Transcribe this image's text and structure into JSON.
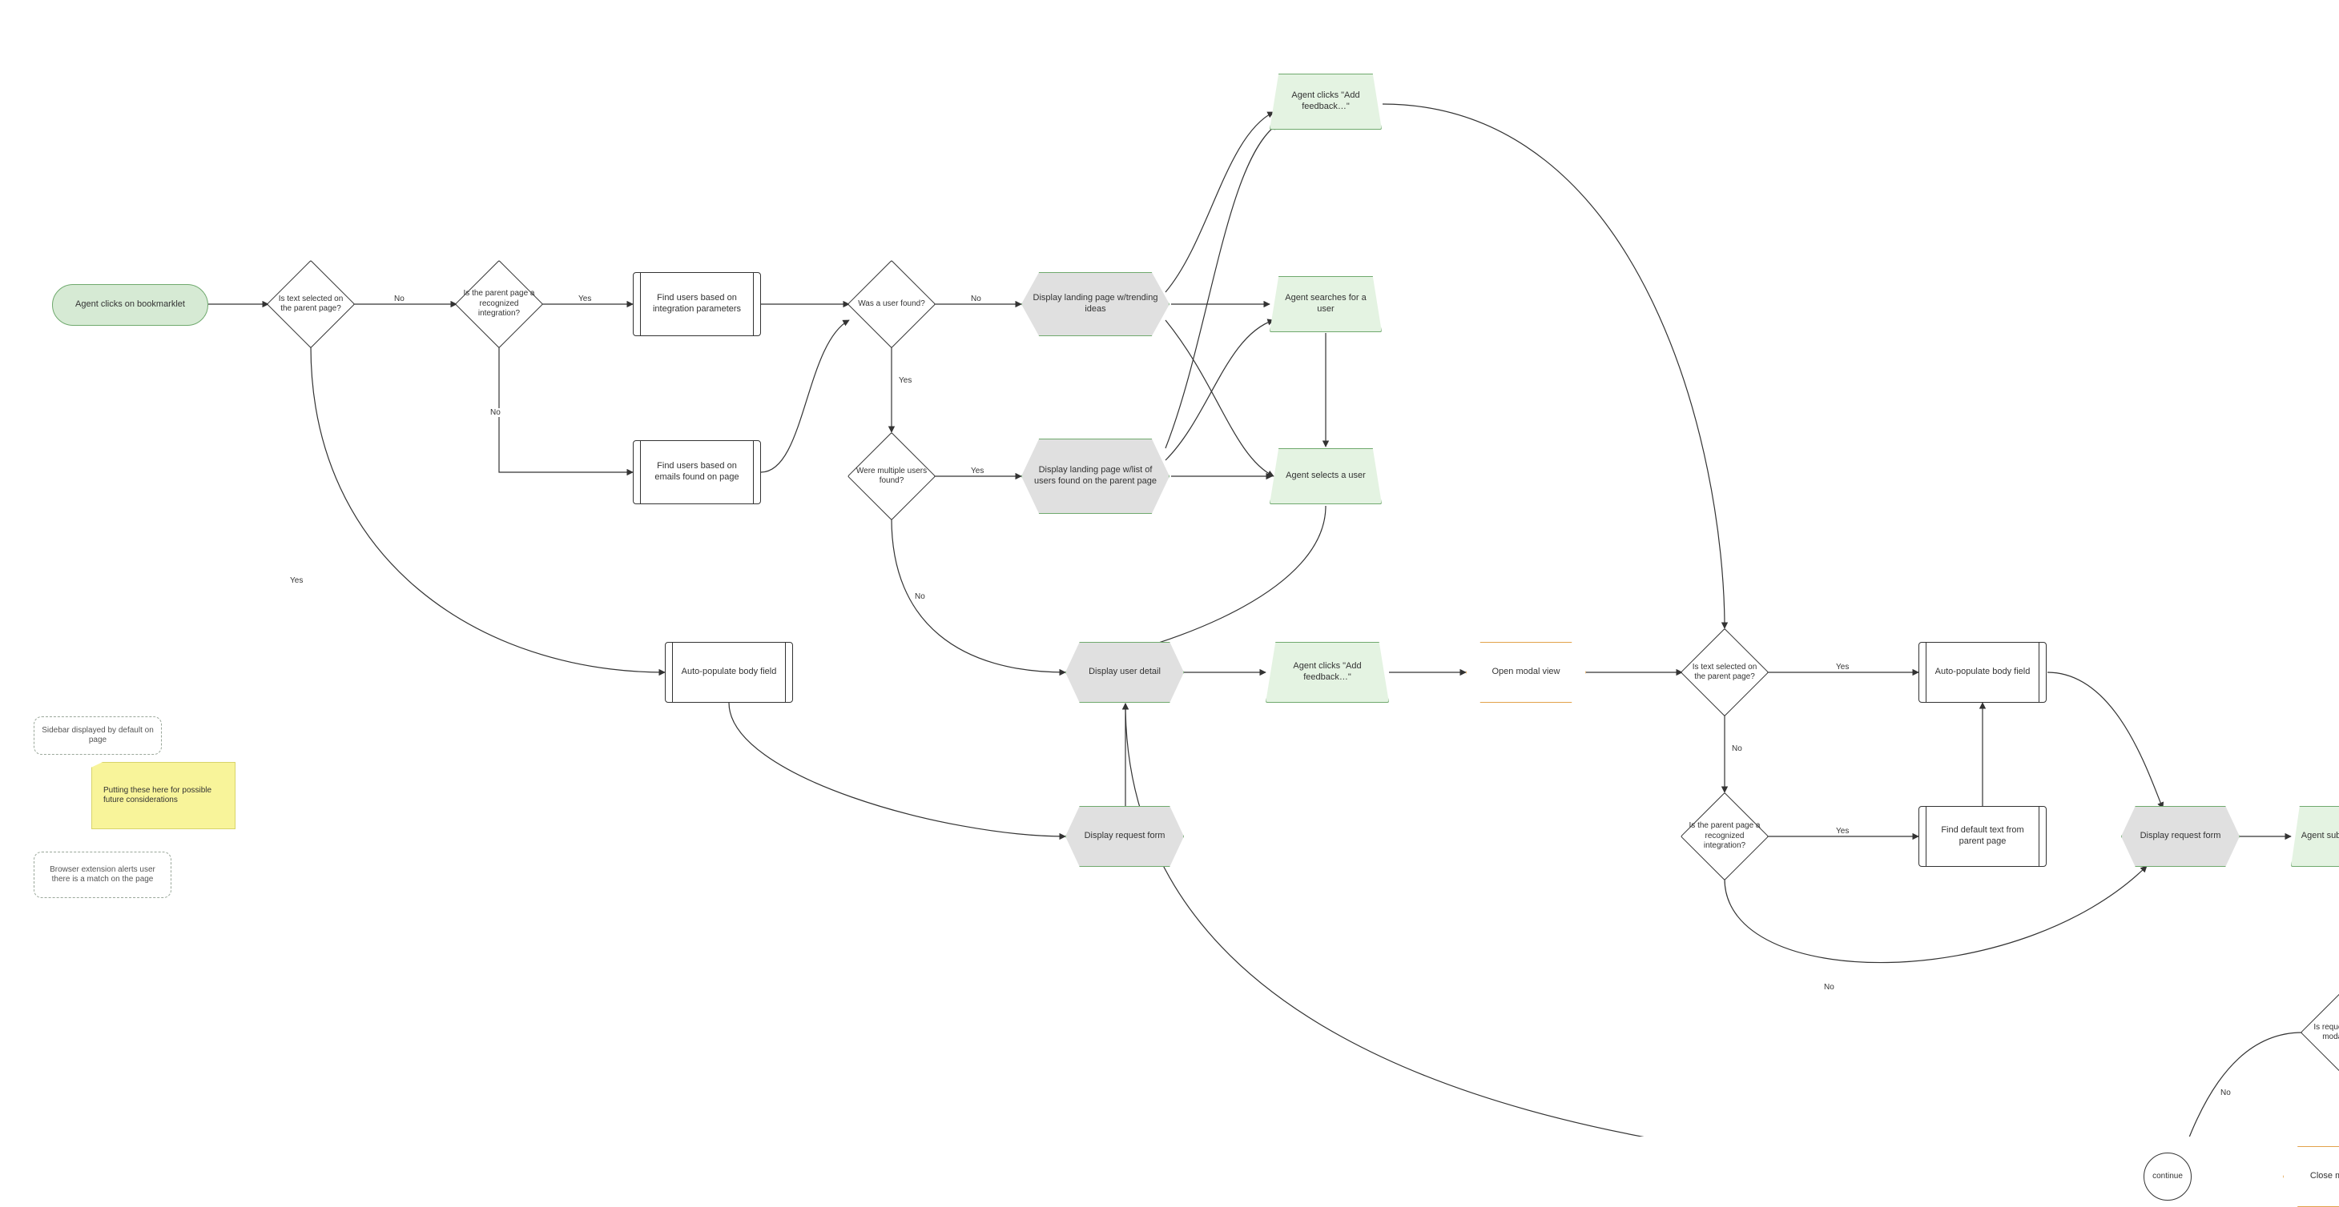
{
  "nodes": {
    "start": {
      "label": "Agent clicks on bookmarklet"
    },
    "d_text_sel_1": {
      "label": "Is text selected on the parent page?"
    },
    "d_recog_1": {
      "label": "Is the parent page a recognized integration?"
    },
    "p_find_int": {
      "label": "Find users based on integration parameters"
    },
    "p_find_email": {
      "label": "Find users based on emails found on page"
    },
    "d_user_found": {
      "label": "Was a user found?"
    },
    "d_multi_found": {
      "label": "Were multiple users found?"
    },
    "disp_trending": {
      "label": "Display landing page w/trending ideas"
    },
    "disp_userlist": {
      "label": "Display landing page w/list of users found on the parent page"
    },
    "ua_add_fb_top": {
      "label": "Agent clicks \"Add feedback…\""
    },
    "ua_search_user": {
      "label": "Agent searches for a user"
    },
    "ua_select_user": {
      "label": "Agent selects a user"
    },
    "p_autopop_1": {
      "label": "Auto-populate body field"
    },
    "disp_user_detail": {
      "label": "Display user detail"
    },
    "ua_add_fb_mid": {
      "label": "Agent clicks \"Add feedback…\""
    },
    "prep_open_modal": {
      "label": "Open modal view"
    },
    "d_text_sel_2": {
      "label": "Is text selected on the parent page?"
    },
    "d_recog_2": {
      "label": "Is the parent page a recognized integration?"
    },
    "p_autopop_2": {
      "label": "Auto-populate body field"
    },
    "p_find_default": {
      "label": "Find default text from parent page"
    },
    "disp_req_form_L": {
      "label": "Display request form"
    },
    "disp_req_form_R": {
      "label": "Display request form"
    },
    "ua_submit": {
      "label": "Agent submits request"
    },
    "d_in_modal": {
      "label": "Is request form in modal view?"
    },
    "prep_close_modal": {
      "label": "Close modal view"
    },
    "conn_continue": {
      "label": "continue"
    },
    "ann_sidebar": {
      "label": "Sidebar displayed by default on page"
    },
    "ann_extension": {
      "label": "Browser extension alerts user there is a match on the page"
    },
    "sticky": {
      "label": "Putting these here for possible future considerations"
    }
  },
  "edge_labels": {
    "no": "No",
    "yes": "Yes"
  },
  "chart_data": {
    "type": "flowchart",
    "nodes": [
      {
        "id": "start",
        "shape": "terminator",
        "text": "Agent clicks on bookmarklet"
      },
      {
        "id": "d_text_sel_1",
        "shape": "decision",
        "text": "Is text selected on the parent page?"
      },
      {
        "id": "d_recog_1",
        "shape": "decision",
        "text": "Is the parent page a recognized integration?"
      },
      {
        "id": "p_find_int",
        "shape": "predefined",
        "text": "Find users based on integration parameters"
      },
      {
        "id": "p_find_email",
        "shape": "predefined",
        "text": "Find users based on emails found on page"
      },
      {
        "id": "d_user_found",
        "shape": "decision",
        "text": "Was a user found?"
      },
      {
        "id": "d_multi_found",
        "shape": "decision",
        "text": "Were multiple users found?"
      },
      {
        "id": "disp_trending",
        "shape": "display",
        "text": "Display landing page w/trending ideas"
      },
      {
        "id": "disp_userlist",
        "shape": "display",
        "text": "Display landing page w/list of users found on the parent page"
      },
      {
        "id": "ua_add_fb_top",
        "shape": "manual-input",
        "text": "Agent clicks \"Add feedback…\""
      },
      {
        "id": "ua_search_user",
        "shape": "manual-input",
        "text": "Agent searches for a user"
      },
      {
        "id": "ua_select_user",
        "shape": "manual-input",
        "text": "Agent selects a user"
      },
      {
        "id": "p_autopop_1",
        "shape": "predefined",
        "text": "Auto-populate body field"
      },
      {
        "id": "disp_user_detail",
        "shape": "display",
        "text": "Display user detail"
      },
      {
        "id": "ua_add_fb_mid",
        "shape": "manual-input",
        "text": "Agent clicks \"Add feedback…\""
      },
      {
        "id": "prep_open_modal",
        "shape": "preparation",
        "text": "Open modal view"
      },
      {
        "id": "d_text_sel_2",
        "shape": "decision",
        "text": "Is text selected on the parent page?"
      },
      {
        "id": "d_recog_2",
        "shape": "decision",
        "text": "Is the parent page a recognized integration?"
      },
      {
        "id": "p_autopop_2",
        "shape": "predefined",
        "text": "Auto-populate body field"
      },
      {
        "id": "p_find_default",
        "shape": "predefined",
        "text": "Find default text from parent page"
      },
      {
        "id": "disp_req_form_L",
        "shape": "display",
        "text": "Display request form"
      },
      {
        "id": "disp_req_form_R",
        "shape": "display",
        "text": "Display request form"
      },
      {
        "id": "ua_submit",
        "shape": "manual-input",
        "text": "Agent submits request"
      },
      {
        "id": "d_in_modal",
        "shape": "decision",
        "text": "Is request form in modal view?"
      },
      {
        "id": "prep_close_modal",
        "shape": "preparation",
        "text": "Close modal view"
      },
      {
        "id": "conn_continue",
        "shape": "connector",
        "text": "continue"
      }
    ],
    "annotations": [
      {
        "id": "ann_sidebar",
        "text": "Sidebar displayed by default on page"
      },
      {
        "id": "ann_extension",
        "text": "Browser extension alerts user there is a match on the page"
      },
      {
        "id": "sticky",
        "text": "Putting these here for possible future considerations"
      }
    ],
    "edges": [
      {
        "from": "start",
        "to": "d_text_sel_1",
        "label": null
      },
      {
        "from": "d_text_sel_1",
        "to": "d_recog_1",
        "label": "No"
      },
      {
        "from": "d_text_sel_1",
        "to": "p_autopop_1",
        "label": "Yes"
      },
      {
        "from": "d_recog_1",
        "to": "p_find_int",
        "label": "Yes"
      },
      {
        "from": "d_recog_1",
        "to": "p_find_email",
        "label": "No"
      },
      {
        "from": "p_find_int",
        "to": "d_user_found",
        "label": null
      },
      {
        "from": "p_find_email",
        "to": "d_user_found",
        "label": null
      },
      {
        "from": "d_user_found",
        "to": "disp_trending",
        "label": "No"
      },
      {
        "from": "d_user_found",
        "to": "d_multi_found",
        "label": "Yes"
      },
      {
        "from": "d_multi_found",
        "to": "disp_userlist",
        "label": "Yes"
      },
      {
        "from": "d_multi_found",
        "to": "disp_user_detail",
        "label": "No"
      },
      {
        "from": "disp_trending",
        "to": "ua_add_fb_top",
        "label": null
      },
      {
        "from": "disp_trending",
        "to": "ua_search_user",
        "label": null
      },
      {
        "from": "disp_trending",
        "to": "ua_select_user",
        "label": null
      },
      {
        "from": "disp_userlist",
        "to": "ua_add_fb_top",
        "label": null
      },
      {
        "from": "disp_userlist",
        "to": "ua_search_user",
        "label": null
      },
      {
        "from": "disp_userlist",
        "to": "ua_select_user",
        "label": null
      },
      {
        "from": "ua_search_user",
        "to": "ua_select_user",
        "label": null
      },
      {
        "from": "ua_select_user",
        "to": "disp_user_detail",
        "label": null
      },
      {
        "from": "disp_user_detail",
        "to": "ua_add_fb_mid",
        "label": null
      },
      {
        "from": "ua_add_fb_mid",
        "to": "prep_open_modal",
        "label": null
      },
      {
        "from": "ua_add_fb_top",
        "to": "d_text_sel_2",
        "label": null
      },
      {
        "from": "prep_open_modal",
        "to": "d_text_sel_2",
        "label": null
      },
      {
        "from": "d_text_sel_2",
        "to": "p_autopop_2",
        "label": "Yes"
      },
      {
        "from": "d_text_sel_2",
        "to": "d_recog_2",
        "label": "No"
      },
      {
        "from": "d_recog_2",
        "to": "p_find_default",
        "label": "Yes"
      },
      {
        "from": "d_recog_2",
        "to": "disp_req_form_R",
        "label": "No"
      },
      {
        "from": "p_find_default",
        "to": "p_autopop_2",
        "label": null
      },
      {
        "from": "p_autopop_2",
        "to": "disp_req_form_R",
        "label": null
      },
      {
        "from": "p_autopop_1",
        "to": "disp_req_form_L",
        "label": null
      },
      {
        "from": "disp_req_form_L",
        "to": "disp_user_detail",
        "label": null
      },
      {
        "from": "disp_req_form_R",
        "to": "ua_submit",
        "label": null
      },
      {
        "from": "ua_submit",
        "to": "d_in_modal",
        "label": null
      },
      {
        "from": "d_in_modal",
        "to": "prep_close_modal",
        "label": "Yes"
      },
      {
        "from": "d_in_modal",
        "to": "conn_continue",
        "label": "No"
      },
      {
        "from": "prep_close_modal",
        "to": "conn_continue",
        "label": null
      },
      {
        "from": "conn_continue",
        "to": "disp_user_detail",
        "label": null
      }
    ]
  }
}
